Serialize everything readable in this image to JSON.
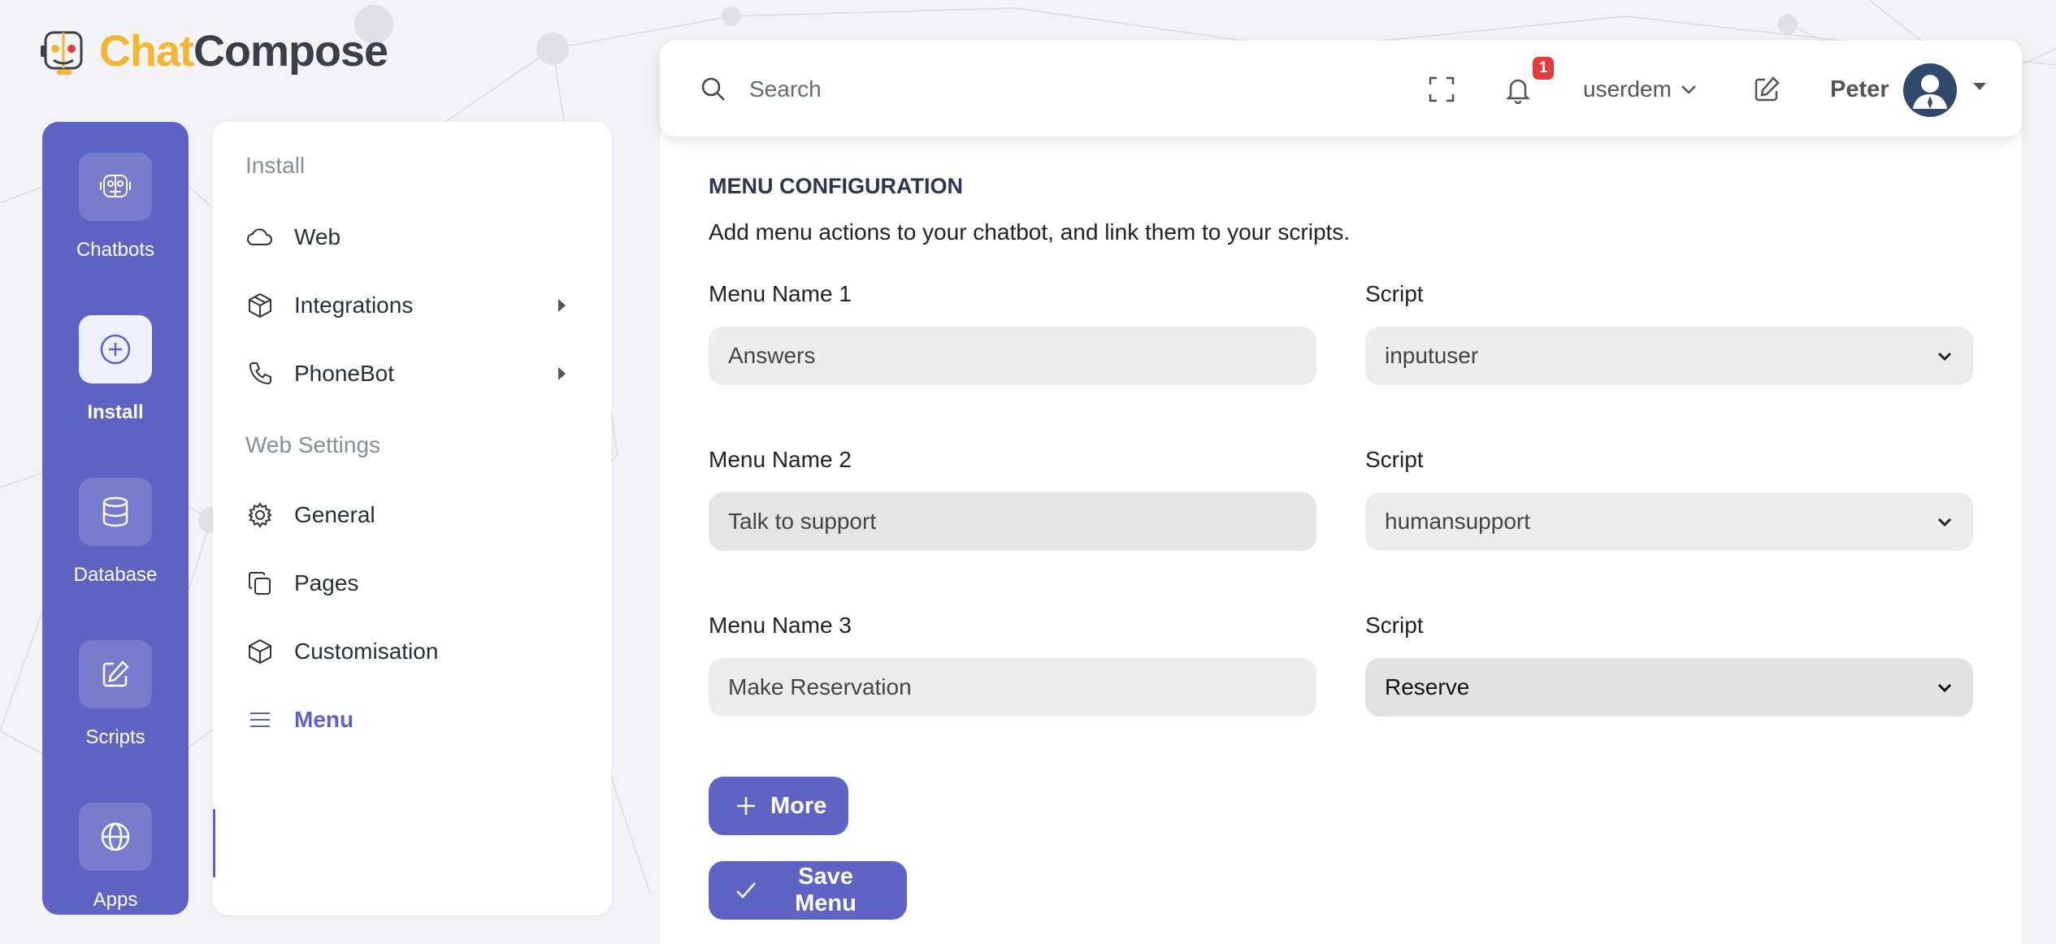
{
  "brand": {
    "part1": "Chat",
    "part2": "Compose"
  },
  "rail": {
    "items": [
      {
        "label": "Chatbots",
        "icon": "robot-icon"
      },
      {
        "label": "Install",
        "icon": "plus-circle-icon",
        "active": true
      },
      {
        "label": "Database",
        "icon": "database-icon"
      },
      {
        "label": "Scripts",
        "icon": "edit-icon"
      },
      {
        "label": "Apps",
        "icon": "globe-icon"
      }
    ]
  },
  "subpanel": {
    "section1": "Install",
    "items1": [
      {
        "label": "Web",
        "icon": "cloud-icon"
      },
      {
        "label": "Integrations",
        "icon": "box-icon"
      },
      {
        "label": "PhoneBot",
        "icon": "phone-icon"
      }
    ],
    "section2": "Web Settings",
    "items2": [
      {
        "label": "General",
        "icon": "gear-icon"
      },
      {
        "label": "Pages",
        "icon": "copy-icon"
      },
      {
        "label": "Customisation",
        "icon": "box-icon"
      },
      {
        "label": "Menu",
        "icon": "menu-icon",
        "active": true
      }
    ]
  },
  "topbar": {
    "search_placeholder": "Search",
    "notification_count": "1",
    "workspace": "userdem",
    "username": "Peter"
  },
  "form": {
    "title": "MENU CONFIGURATION",
    "description": "Add menu actions to your chatbot, and link them to your scripts.",
    "script_label": "Script",
    "rows": [
      {
        "name_label": "Menu Name 1",
        "name_value": "Answers",
        "script_value": "inputuser"
      },
      {
        "name_label": "Menu Name 2",
        "name_value": "Talk to support",
        "script_value": "humansupport"
      },
      {
        "name_label": "Menu Name 3",
        "name_value": "Make Reservation",
        "script_value": "Reserve"
      }
    ],
    "more_button": "More",
    "save_button": "Save Menu"
  },
  "colors": {
    "accent": "#5f63c3",
    "badge": "#e53b3b",
    "brand_yellow": "#f2b632",
    "brand_dark": "#3c3f4a"
  }
}
